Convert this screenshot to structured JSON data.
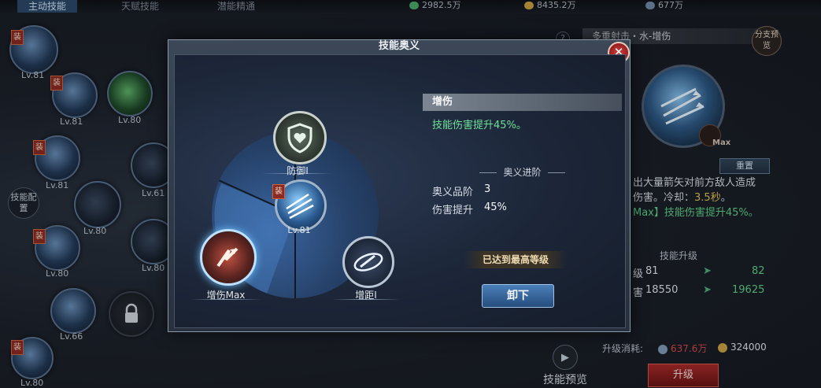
{
  "topbar": {
    "tabs": [
      "主动技能",
      "天赋技能",
      "潜能精通"
    ],
    "resources": [
      "2982.5万",
      "8435.2万",
      "677万"
    ]
  },
  "left_skills": [
    {
      "level": "Lv.81",
      "equipped": true
    },
    {
      "level": "Lv.81",
      "equipped": true
    },
    {
      "level": "Lv.80",
      "equipped": false
    },
    {
      "level": "Lv.81",
      "equipped": true
    },
    {
      "level": "Lv.61",
      "equipped": false
    },
    {
      "level": "Lv.80",
      "equipped": false
    },
    {
      "level": "Lv.80",
      "equipped": true
    },
    {
      "level": "Lv.80",
      "equipped": false
    },
    {
      "level": "Lv.66",
      "equipped": false
    },
    {
      "level": "Lv.80",
      "equipped": true
    }
  ],
  "equip_badge": "装",
  "skill_config_label": "技能配置",
  "right_panel": {
    "help": "?",
    "title": "多重射击・水-增伤",
    "branch_preview": "分支预览",
    "max_label": "Max",
    "reset_label": "重置",
    "desc_line1": "出大量箭矢对前方敌人造成",
    "desc_line2_prefix": "伤害。冷却：",
    "desc_cooldown": "3.5秒",
    "desc_line2_suffix": "。",
    "desc_line3": "Max】技能伤害提升45%。",
    "upgrade_header": "技能升级",
    "rows": [
      {
        "label": "级",
        "current": "81",
        "next": "82"
      },
      {
        "label": "害",
        "current": "18550",
        "next": "19625"
      }
    ],
    "cost_label": "升级消耗:",
    "cost_1": "637.6万",
    "cost_2": "324000",
    "upgrade_button": "升级"
  },
  "preview": {
    "label": "技能预览"
  },
  "modal": {
    "title": "技能奥义",
    "close": "✕",
    "nodes": {
      "defense": {
        "label": "防御Ⅰ"
      },
      "center": {
        "label": "Lv.81",
        "badge": "装"
      },
      "damage": {
        "label": "增伤Max"
      },
      "range": {
        "label": "增距Ⅰ"
      }
    },
    "info": {
      "heading": "增伤",
      "description": "技能伤害提升45%。",
      "section": "奥义进阶",
      "stats": [
        {
          "label": "奥义品阶",
          "value": "3"
        },
        {
          "label": "伤害提升",
          "value": "45%"
        }
      ]
    },
    "max_level_label": "已达到最高等级",
    "unload_button": "卸下"
  }
}
